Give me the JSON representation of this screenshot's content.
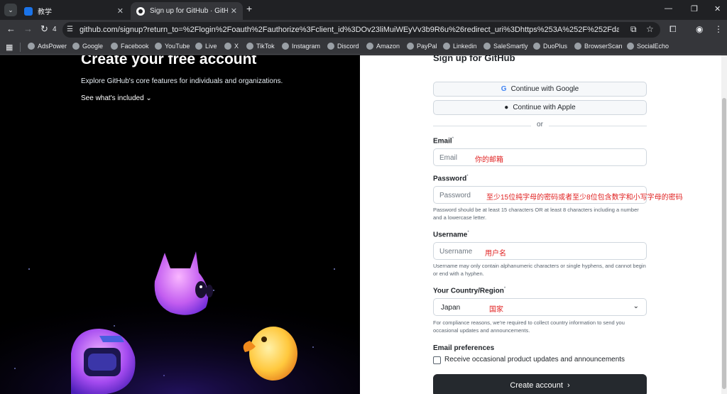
{
  "browser": {
    "tabs": [
      {
        "title": "教学",
        "active": false
      },
      {
        "title": "Sign up for GitHub · GitHub",
        "active": true
      }
    ],
    "tab_count": "4",
    "url": "github.com/signup?return_to=%2Flogin%2Foauth%2Fauthorize%3Fclient_id%3DOv23liMuiWEyVv3b9R6u%26redirect_uri%3Dhttps%253A%252F%252Fdash.domain.digita...",
    "bookmarks": [
      "AdsPower",
      "Google",
      "Facebook",
      "YouTube",
      "Live",
      "X",
      "TikTok",
      "Instagram",
      "Discord",
      "Amazon",
      "PayPal",
      "Linkedin",
      "SaleSmartly",
      "DuoPlus",
      "BrowserScan",
      "SocialEcho"
    ]
  },
  "hero": {
    "title": "Create your free account",
    "subtitle": "Explore GitHub's core features for individuals and organizations.",
    "link": "See what's included"
  },
  "form": {
    "title": "Sign up for GitHub",
    "google": "Continue with Google",
    "apple": "Continue with Apple",
    "or": "or",
    "email": {
      "label": "Email",
      "required": "*",
      "placeholder": "Email",
      "note": "你的邮箱"
    },
    "password": {
      "label": "Password",
      "required": "*",
      "placeholder": "Password",
      "note": "至少15位纯字母的密码或者至少8位包含数字和小写字母的密码",
      "help": "Password should be at least 15 characters OR at least 8 characters including a number and a lowercase letter."
    },
    "username": {
      "label": "Username",
      "required": "*",
      "placeholder": "Username",
      "note": "用户名",
      "help": "Username may only contain alphanumeric characters or single hyphens, and cannot begin or end with a hyphen."
    },
    "country": {
      "label": "Your Country/Region",
      "required": "*",
      "value": "Japan",
      "note": "国家",
      "help": "For compliance reasons, we're required to collect country information to send you occasional updates and announcements."
    },
    "email_prefs": {
      "label": "Email preferences",
      "checkbox": "Receive occasional product updates and announcements"
    },
    "submit": "Create account"
  },
  "icons": {
    "back": "arrow-left-icon",
    "forward": "arrow-right-icon",
    "reload": "reload-icon",
    "google": "google-icon",
    "apple": "apple-icon",
    "chevron": "chevron-down-icon"
  }
}
